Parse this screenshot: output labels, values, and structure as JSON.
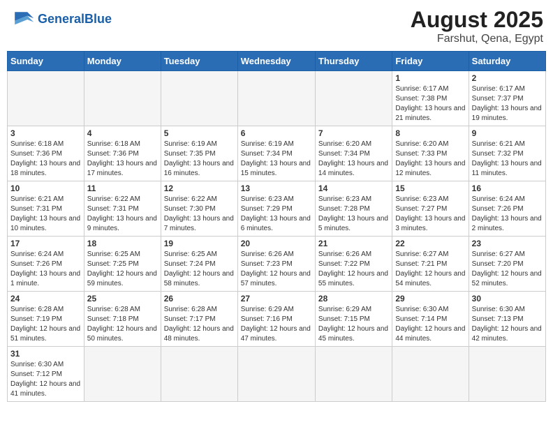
{
  "header": {
    "logo_general": "General",
    "logo_blue": "Blue",
    "main_title": "August 2025",
    "subtitle": "Farshut, Qena, Egypt"
  },
  "days_of_week": [
    "Sunday",
    "Monday",
    "Tuesday",
    "Wednesday",
    "Thursday",
    "Friday",
    "Saturday"
  ],
  "weeks": [
    [
      {
        "day": "",
        "info": ""
      },
      {
        "day": "",
        "info": ""
      },
      {
        "day": "",
        "info": ""
      },
      {
        "day": "",
        "info": ""
      },
      {
        "day": "",
        "info": ""
      },
      {
        "day": "1",
        "info": "Sunrise: 6:17 AM\nSunset: 7:38 PM\nDaylight: 13 hours and 21 minutes."
      },
      {
        "day": "2",
        "info": "Sunrise: 6:17 AM\nSunset: 7:37 PM\nDaylight: 13 hours and 19 minutes."
      }
    ],
    [
      {
        "day": "3",
        "info": "Sunrise: 6:18 AM\nSunset: 7:36 PM\nDaylight: 13 hours and 18 minutes."
      },
      {
        "day": "4",
        "info": "Sunrise: 6:18 AM\nSunset: 7:36 PM\nDaylight: 13 hours and 17 minutes."
      },
      {
        "day": "5",
        "info": "Sunrise: 6:19 AM\nSunset: 7:35 PM\nDaylight: 13 hours and 16 minutes."
      },
      {
        "day": "6",
        "info": "Sunrise: 6:19 AM\nSunset: 7:34 PM\nDaylight: 13 hours and 15 minutes."
      },
      {
        "day": "7",
        "info": "Sunrise: 6:20 AM\nSunset: 7:34 PM\nDaylight: 13 hours and 14 minutes."
      },
      {
        "day": "8",
        "info": "Sunrise: 6:20 AM\nSunset: 7:33 PM\nDaylight: 13 hours and 12 minutes."
      },
      {
        "day": "9",
        "info": "Sunrise: 6:21 AM\nSunset: 7:32 PM\nDaylight: 13 hours and 11 minutes."
      }
    ],
    [
      {
        "day": "10",
        "info": "Sunrise: 6:21 AM\nSunset: 7:31 PM\nDaylight: 13 hours and 10 minutes."
      },
      {
        "day": "11",
        "info": "Sunrise: 6:22 AM\nSunset: 7:31 PM\nDaylight: 13 hours and 9 minutes."
      },
      {
        "day": "12",
        "info": "Sunrise: 6:22 AM\nSunset: 7:30 PM\nDaylight: 13 hours and 7 minutes."
      },
      {
        "day": "13",
        "info": "Sunrise: 6:23 AM\nSunset: 7:29 PM\nDaylight: 13 hours and 6 minutes."
      },
      {
        "day": "14",
        "info": "Sunrise: 6:23 AM\nSunset: 7:28 PM\nDaylight: 13 hours and 5 minutes."
      },
      {
        "day": "15",
        "info": "Sunrise: 6:23 AM\nSunset: 7:27 PM\nDaylight: 13 hours and 3 minutes."
      },
      {
        "day": "16",
        "info": "Sunrise: 6:24 AM\nSunset: 7:26 PM\nDaylight: 13 hours and 2 minutes."
      }
    ],
    [
      {
        "day": "17",
        "info": "Sunrise: 6:24 AM\nSunset: 7:26 PM\nDaylight: 13 hours and 1 minute."
      },
      {
        "day": "18",
        "info": "Sunrise: 6:25 AM\nSunset: 7:25 PM\nDaylight: 12 hours and 59 minutes."
      },
      {
        "day": "19",
        "info": "Sunrise: 6:25 AM\nSunset: 7:24 PM\nDaylight: 12 hours and 58 minutes."
      },
      {
        "day": "20",
        "info": "Sunrise: 6:26 AM\nSunset: 7:23 PM\nDaylight: 12 hours and 57 minutes."
      },
      {
        "day": "21",
        "info": "Sunrise: 6:26 AM\nSunset: 7:22 PM\nDaylight: 12 hours and 55 minutes."
      },
      {
        "day": "22",
        "info": "Sunrise: 6:27 AM\nSunset: 7:21 PM\nDaylight: 12 hours and 54 minutes."
      },
      {
        "day": "23",
        "info": "Sunrise: 6:27 AM\nSunset: 7:20 PM\nDaylight: 12 hours and 52 minutes."
      }
    ],
    [
      {
        "day": "24",
        "info": "Sunrise: 6:28 AM\nSunset: 7:19 PM\nDaylight: 12 hours and 51 minutes."
      },
      {
        "day": "25",
        "info": "Sunrise: 6:28 AM\nSunset: 7:18 PM\nDaylight: 12 hours and 50 minutes."
      },
      {
        "day": "26",
        "info": "Sunrise: 6:28 AM\nSunset: 7:17 PM\nDaylight: 12 hours and 48 minutes."
      },
      {
        "day": "27",
        "info": "Sunrise: 6:29 AM\nSunset: 7:16 PM\nDaylight: 12 hours and 47 minutes."
      },
      {
        "day": "28",
        "info": "Sunrise: 6:29 AM\nSunset: 7:15 PM\nDaylight: 12 hours and 45 minutes."
      },
      {
        "day": "29",
        "info": "Sunrise: 6:30 AM\nSunset: 7:14 PM\nDaylight: 12 hours and 44 minutes."
      },
      {
        "day": "30",
        "info": "Sunrise: 6:30 AM\nSunset: 7:13 PM\nDaylight: 12 hours and 42 minutes."
      }
    ],
    [
      {
        "day": "31",
        "info": "Sunrise: 6:30 AM\nSunset: 7:12 PM\nDaylight: 12 hours and 41 minutes."
      },
      {
        "day": "",
        "info": ""
      },
      {
        "day": "",
        "info": ""
      },
      {
        "day": "",
        "info": ""
      },
      {
        "day": "",
        "info": ""
      },
      {
        "day": "",
        "info": ""
      },
      {
        "day": "",
        "info": ""
      }
    ]
  ]
}
